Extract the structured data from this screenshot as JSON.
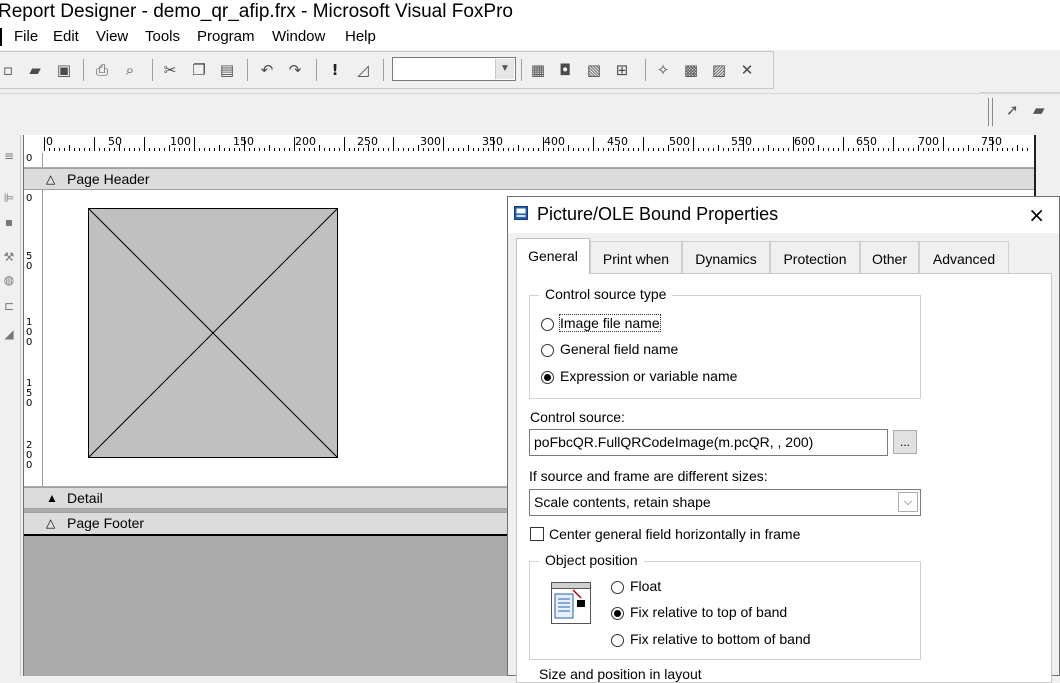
{
  "window": {
    "title": "Report Designer - demo_qr_afip.frx - Microsoft Visual FoxPro"
  },
  "menu": {
    "items": [
      "File",
      "Edit",
      "View",
      "Tools",
      "Program",
      "Window",
      "Help"
    ]
  },
  "toolbar": {
    "icons": [
      "new-icon",
      "open-icon",
      "save-icon",
      "print-icon",
      "print-preview-icon",
      "cut-icon",
      "copy-icon",
      "paste-icon",
      "undo-icon",
      "redo-icon",
      "run-icon",
      "modify-form-icon",
      "data-environment-icon",
      "report-controls-icon",
      "color-palette-icon",
      "layout-icon",
      "form-wizard-icon",
      "auto-format-icon",
      "options-icon",
      "builder-icon"
    ],
    "combo_value": ""
  },
  "ruler": {
    "labels": [
      "0",
      "50",
      "100",
      "150",
      "200",
      "250",
      "300",
      "350",
      "400",
      "450",
      "500",
      "550",
      "600",
      "650",
      "700",
      "750"
    ]
  },
  "bands": {
    "page_header": "Page Header",
    "detail": "Detail",
    "page_footer": "Page Footer",
    "vruler_top": "0",
    "vruler_labels": [
      "0",
      "5\n0",
      "1\n0\n0",
      "1\n5\n0",
      "2\n0\n0"
    ]
  },
  "dialog": {
    "title": "Picture/OLE Bound Properties",
    "close": "×",
    "tabs": [
      "General",
      "Print when",
      "Dynamics",
      "Protection",
      "Other",
      "Advanced"
    ],
    "active_tab": "General",
    "control_source_type": {
      "legend": "Control source type",
      "options": [
        "Image file name",
        "General field name",
        "Expression or variable name"
      ],
      "selected": "Expression or variable name"
    },
    "control_source": {
      "label": "Control source:",
      "value": "poFbcQR.FullQRCodeImage(m.pcQR, , 200)",
      "browse": "..."
    },
    "size_mode": {
      "label": "If source and frame are different sizes:",
      "value": "Scale contents, retain shape"
    },
    "center_general": {
      "label": "Center general field horizontally in frame",
      "checked": false
    },
    "object_position": {
      "legend": "Object position",
      "options": [
        "Float",
        "Fix relative to top of band",
        "Fix relative to bottom of band"
      ],
      "selected": "Fix relative to top of band"
    },
    "size_position_legend": "Size and position in layout"
  },
  "colors": {
    "accent": "#1f5fb5",
    "band": "#dcdcdc",
    "canvas": "#ababab",
    "picture_fill": "#c0c0c0"
  }
}
